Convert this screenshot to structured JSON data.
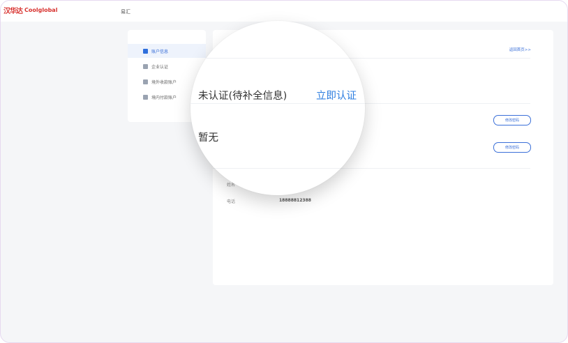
{
  "brand": {
    "mark": "汉华达",
    "name": "Coolglobal"
  },
  "topnav": {
    "item": "易汇"
  },
  "sidebar": {
    "items": [
      {
        "label": "账户信息",
        "active": true
      },
      {
        "label": "企业认证",
        "active": false
      },
      {
        "label": "境外收款账户",
        "active": false
      },
      {
        "label": "境内付款账户",
        "active": false
      }
    ]
  },
  "main": {
    "back_link": "返回首页>>",
    "buttons": [
      "修改密码",
      "修改密码"
    ],
    "info": [
      {
        "label": "姓名",
        "value": ""
      },
      {
        "label": "电话",
        "value": "18888812388"
      }
    ]
  },
  "magnifier": {
    "status": "未认证(待补全信息)",
    "action": "立即认证",
    "empty": "暂无"
  },
  "colors": {
    "accent": "#2f7fe0",
    "brand": "#d8322f",
    "bg": "#f5f6f8"
  }
}
